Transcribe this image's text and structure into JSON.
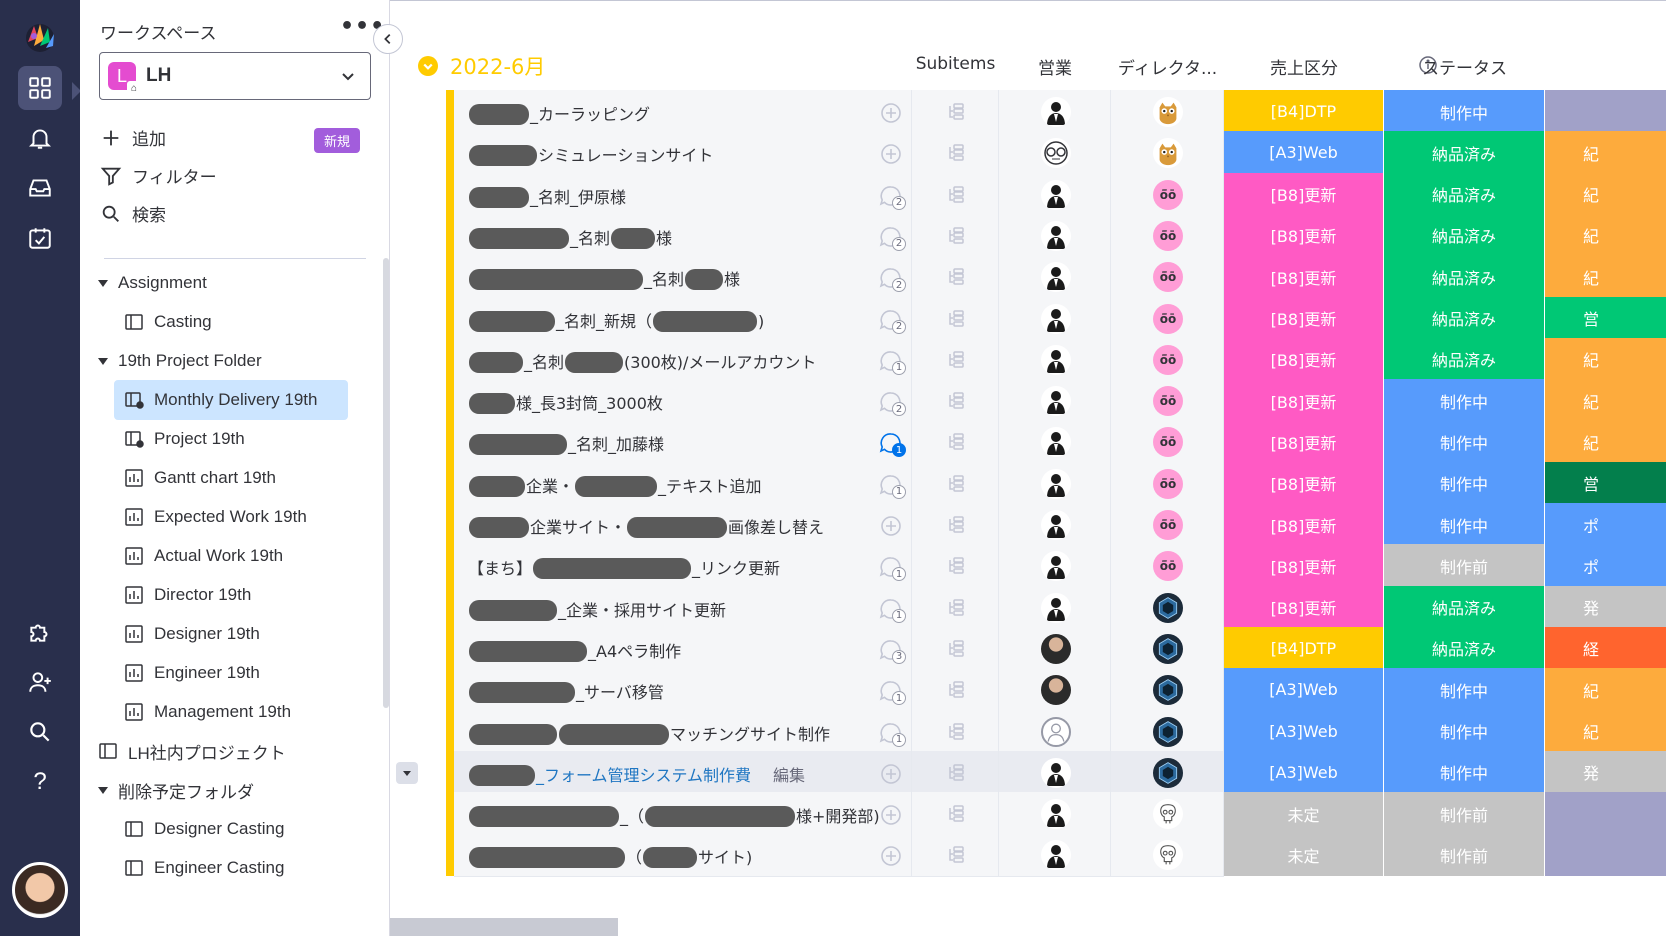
{
  "colors": {
    "rail_bg": "#292f4c",
    "group_yellow": "#ffcb00",
    "selected_bg": "#cce5ff",
    "label_colors": {
      "[B4]DTP": "#ffcb00",
      "[A3]Web": "#579bfc",
      "[B8]更新": "#ff5ac4",
      "未定": "#c4c4c4",
      "制作中": "#579bfc",
      "納品済み": "#00c875",
      "制作前": "#c4c4c4"
    }
  },
  "rail": {
    "icons": [
      "logo-icon",
      "workspace-grid-icon",
      "bell-icon",
      "inbox-icon",
      "my-work-calendar-icon",
      "puzzle-icon",
      "invite-user-icon",
      "search-icon",
      "help-icon"
    ],
    "help_label": "?"
  },
  "sidebar": {
    "workspace_label": "ワークスペース",
    "more_label": "•••",
    "workspace": {
      "badge": "L",
      "name": "LH"
    },
    "actions": [
      {
        "icon": "plus-icon",
        "label": "追加"
      },
      {
        "icon": "filter-icon",
        "label": "フィルター"
      },
      {
        "icon": "search-icon",
        "label": "検索"
      }
    ],
    "new_badge": "新規",
    "tree": [
      {
        "label": "Assignment",
        "type": "folder"
      },
      {
        "label": "Casting",
        "type": "board"
      },
      {
        "label": "19th Project Folder",
        "type": "folder"
      },
      {
        "label": "Monthly Delivery 19th",
        "type": "board-shared",
        "selected": true
      },
      {
        "label": "Project 19th",
        "type": "board-shared"
      },
      {
        "label": "Gantt chart 19th",
        "type": "dashboard"
      },
      {
        "label": "Expected Work 19th",
        "type": "dashboard"
      },
      {
        "label": "Actual Work 19th",
        "type": "dashboard"
      },
      {
        "label": "Director 19th",
        "type": "dashboard"
      },
      {
        "label": "Designer 19th",
        "type": "dashboard"
      },
      {
        "label": "Engineer 19th",
        "type": "dashboard"
      },
      {
        "label": "Management 19th",
        "type": "dashboard"
      },
      {
        "label": "LH社内プロジェクト",
        "type": "board"
      },
      {
        "label": "削除予定フォルダ",
        "type": "folder"
      },
      {
        "label": "Designer Casting",
        "type": "board"
      },
      {
        "label": "Engineer Casting",
        "type": "board"
      }
    ]
  },
  "board": {
    "group_title": "2022-6月",
    "columns": {
      "subitems": "Subitems",
      "sales": "営業",
      "director": "ディレクタ...",
      "kubun": "売上区分",
      "status": "ステータス"
    },
    "rows": [
      {
        "parts": [
          "r:60",
          "_カーラッピング"
        ],
        "updates": "",
        "sales": "dark-suit",
        "director": "owl",
        "kubun": "[B4]DTP",
        "status": "制作中",
        "extra": "",
        "extra_color": "#a1a1c8"
      },
      {
        "parts": [
          "r:68",
          "シミュレーションサイト"
        ],
        "updates": "",
        "sales": "glasses",
        "director": "owl",
        "kubun": "[A3]Web",
        "status": "納品済み",
        "extra": "紀",
        "extra_color": "#fdab3d"
      },
      {
        "parts": [
          "r:60",
          "_名刺_伊原様"
        ],
        "updates": "2",
        "sales": "dark-suit",
        "director": "pink",
        "kubun": "[B8]更新",
        "status": "納品済み",
        "extra": "紀",
        "extra_color": "#fdab3d"
      },
      {
        "parts": [
          "r:100",
          "_名刺",
          "r:44",
          "様"
        ],
        "updates": "2",
        "sales": "dark-suit",
        "director": "pink",
        "kubun": "[B8]更新",
        "status": "納品済み",
        "extra": "紀",
        "extra_color": "#fdab3d"
      },
      {
        "parts": [
          "r:174",
          "_名刺",
          "r:38",
          "様"
        ],
        "updates": "2",
        "sales": "dark-suit",
        "director": "pink",
        "kubun": "[B8]更新",
        "status": "納品済み",
        "extra": "紀",
        "extra_color": "#fdab3d"
      },
      {
        "parts": [
          "r:86",
          "_名刺_新規（",
          "r:104",
          ")"
        ],
        "updates": "2",
        "sales": "dark-suit",
        "director": "pink",
        "kubun": "[B8]更新",
        "status": "納品済み",
        "extra": "営",
        "extra_color": "#00c875"
      },
      {
        "parts": [
          "r:54",
          "_名刺",
          "r:58",
          "(300枚)/メールアカウント"
        ],
        "updates": "1",
        "sales": "dark-suit",
        "director": "pink",
        "kubun": "[B8]更新",
        "status": "納品済み",
        "extra": "紀",
        "extra_color": "#fdab3d"
      },
      {
        "parts": [
          "r:46",
          "様_長3封筒_3000枚"
        ],
        "updates": "2",
        "sales": "dark-suit",
        "director": "pink",
        "kubun": "[B8]更新",
        "status": "制作中",
        "extra": "紀",
        "extra_color": "#fdab3d"
      },
      {
        "parts": [
          "r:98",
          "_名刺_加藤様"
        ],
        "updates": "1",
        "updates_blue": true,
        "sales": "dark-suit",
        "director": "pink",
        "kubun": "[B8]更新",
        "status": "制作中",
        "extra": "紀",
        "extra_color": "#fdab3d"
      },
      {
        "parts": [
          "r:56",
          "企業・",
          "r:82",
          "_テキスト追加"
        ],
        "updates": "1",
        "sales": "dark-suit",
        "director": "pink",
        "kubun": "[B8]更新",
        "status": "制作中",
        "extra": "営",
        "extra_color": "#037f4c"
      },
      {
        "parts": [
          "r:60",
          "企業サイト・",
          "r:100",
          "画像差し替え"
        ],
        "updates": "",
        "sales": "dark-suit",
        "director": "pink",
        "kubun": "[B8]更新",
        "status": "制作中",
        "extra": "ポ",
        "extra_color": "#579bfc"
      },
      {
        "parts": [
          "【まち】",
          "r:158",
          "_リンク更新"
        ],
        "updates": "1",
        "sales": "dark-suit",
        "director": "pink",
        "kubun": "[B8]更新",
        "status": "制作前",
        "extra": "ポ",
        "extra_color": "#579bfc"
      },
      {
        "parts": [
          "r:88",
          "_企業・採用サイト更新"
        ],
        "updates": "1",
        "sales": "dark-suit",
        "director": "hex",
        "kubun": "[B8]更新",
        "status": "納品済み",
        "extra": "発",
        "extra_color": "#c4c4c4"
      },
      {
        "parts": [
          "r:118",
          "_A4ペラ制作"
        ],
        "updates": "3",
        "sales": "photo",
        "director": "hex",
        "kubun": "[B4]DTP",
        "status": "納品済み",
        "extra": "経",
        "extra_color": "#ff642e"
      },
      {
        "parts": [
          "r:106",
          "_サーバ移管"
        ],
        "updates": "1",
        "sales": "photo",
        "director": "hex",
        "kubun": "[A3]Web",
        "status": "制作中",
        "extra": "紀",
        "extra_color": "#fdab3d"
      },
      {
        "parts": [
          "r:88",
          "r:110",
          "マッチングサイト制作"
        ],
        "updates": "1",
        "sales": "empty",
        "director": "hex",
        "kubun": "[A3]Web",
        "status": "制作中",
        "extra": "紀",
        "extra_color": "#fdab3d"
      },
      {
        "parts": [
          "r:66",
          "link:_フォーム管理システム制作費",
          "edit:編集"
        ],
        "updates": "",
        "sales": "dark-suit",
        "director": "hex",
        "kubun": "[A3]Web",
        "status": "制作中",
        "extra": "発",
        "extra_color": "#c4c4c4",
        "highlight": true
      },
      {
        "parts": [
          "r:150",
          "_（",
          "r:150",
          "様+開発部)"
        ],
        "updates": "",
        "sales": "dark-suit",
        "director": "skull",
        "kubun": "未定",
        "status": "制作前",
        "extra": "",
        "extra_color": "#a1a1c8"
      },
      {
        "parts": [
          "r:156",
          "（",
          "r:54",
          "サイト)"
        ],
        "updates": "",
        "sales": "dark-suit",
        "director": "skull",
        "kubun": "未定",
        "status": "制作前",
        "extra": "",
        "extra_color": "#a1a1c8"
      }
    ]
  }
}
